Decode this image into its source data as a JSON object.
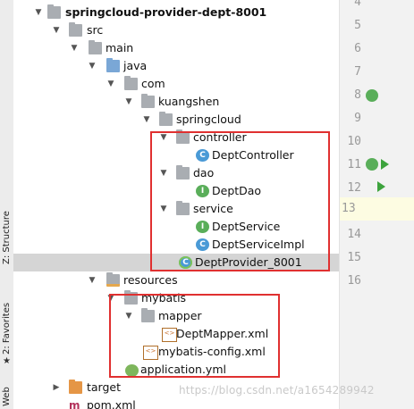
{
  "sidebar_tabs": {
    "structure": "Z: Structure",
    "favorites": "2: Favorites",
    "web": "Web"
  },
  "tree": [
    {
      "label": "springcloud-provider-dept-8001",
      "icon": "module-folder-icon",
      "expanded": true,
      "bold": true
    },
    {
      "label": "src",
      "icon": "folder-icon",
      "expanded": true
    },
    {
      "label": "main",
      "icon": "folder-icon",
      "expanded": true
    },
    {
      "label": "java",
      "icon": "source-folder-icon",
      "expanded": true
    },
    {
      "label": "com",
      "icon": "package-icon",
      "expanded": true
    },
    {
      "label": "kuangshen",
      "icon": "package-icon",
      "expanded": true
    },
    {
      "label": "springcloud",
      "icon": "package-icon",
      "expanded": true
    },
    {
      "label": "controller",
      "icon": "package-icon",
      "expanded": true
    },
    {
      "label": "DeptController",
      "icon": "class-icon"
    },
    {
      "label": "dao",
      "icon": "package-icon",
      "expanded": true
    },
    {
      "label": "DeptDao",
      "icon": "interface-icon"
    },
    {
      "label": "service",
      "icon": "package-icon",
      "expanded": true
    },
    {
      "label": "DeptService",
      "icon": "interface-icon"
    },
    {
      "label": "DeptServiceImpl",
      "icon": "class-icon"
    },
    {
      "label": "DeptProvider_8001",
      "icon": "spring-boot-class-icon",
      "selected": true
    },
    {
      "label": "resources",
      "icon": "resources-folder-icon",
      "expanded": true
    },
    {
      "label": "mybatis",
      "icon": "folder-icon",
      "expanded": true
    },
    {
      "label": "mapper",
      "icon": "folder-icon",
      "expanded": true
    },
    {
      "label": "DeptMapper.xml",
      "icon": "xml-file-icon"
    },
    {
      "label": "mybatis-config.xml",
      "icon": "xml-file-icon"
    },
    {
      "label": "application.yml",
      "icon": "yaml-file-icon"
    },
    {
      "label": "target",
      "icon": "excluded-folder-icon",
      "expanded": false
    },
    {
      "label": "pom.xml",
      "icon": "maven-file-icon"
    }
  ],
  "gutter": {
    "line_numbers": [
      "4",
      "5",
      "6",
      "7",
      "8",
      "9",
      "10",
      "11",
      "12",
      "13",
      "14",
      "15",
      "16"
    ],
    "current_line": "13"
  },
  "watermark": "https://blog.csdn.net/a1654289942"
}
